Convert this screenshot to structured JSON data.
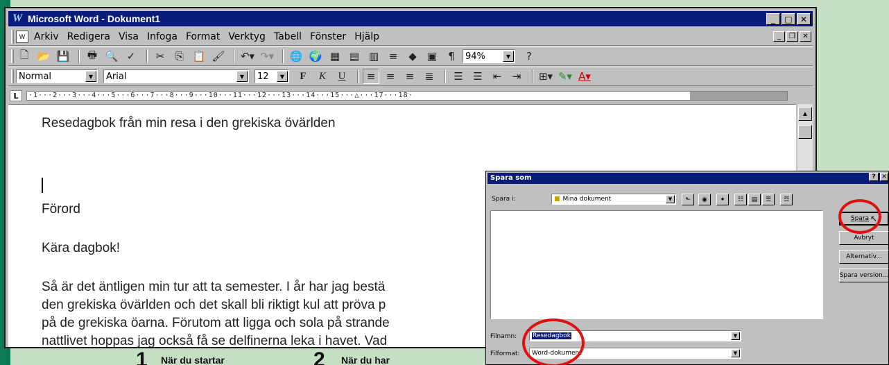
{
  "word": {
    "title": "Microsoft Word - Dokument1",
    "menu": [
      "Arkiv",
      "Redigera",
      "Visa",
      "Infoga",
      "Format",
      "Verktyg",
      "Tabell",
      "Fönster",
      "Hjälp"
    ],
    "zoom": "94%",
    "style": "Normal",
    "font": "Arial",
    "size": "12",
    "ruler": "·1···2···3···4···5···6···7···8···9···10···11···12···13···14···15···△···17···18·",
    "doc_lines": [
      "Resedagbok från min resa i den grekiska övärlden",
      "Förord",
      "Kära dagbok!",
      "Så är det äntligen min tur att ta semester. I år har jag bestä",
      "den grekiska övärlden och det skall bli riktigt kul att pröva p",
      "på de grekiska öarna. Förutom att ligga och sola på strande",
      "nattlivet hoppas jag också få se delfinerna leka i havet. Vad"
    ]
  },
  "dialog": {
    "title": "Spara som",
    "save_in_label": "Spara i:",
    "folder": "Mina dokument",
    "filename_label": "Filnamn:",
    "filename": "Resedagbok",
    "filetype_label": "Filformat:",
    "filetype": "Word-dokument",
    "buttons": {
      "save": "Spara",
      "cancel": "Avbryt",
      "options": "Alternativ...",
      "version": "Spara version..."
    }
  },
  "captions": {
    "step1_num": "1",
    "step1_text": "När du startar",
    "step2_num": "2",
    "step2_text": "När du har"
  }
}
